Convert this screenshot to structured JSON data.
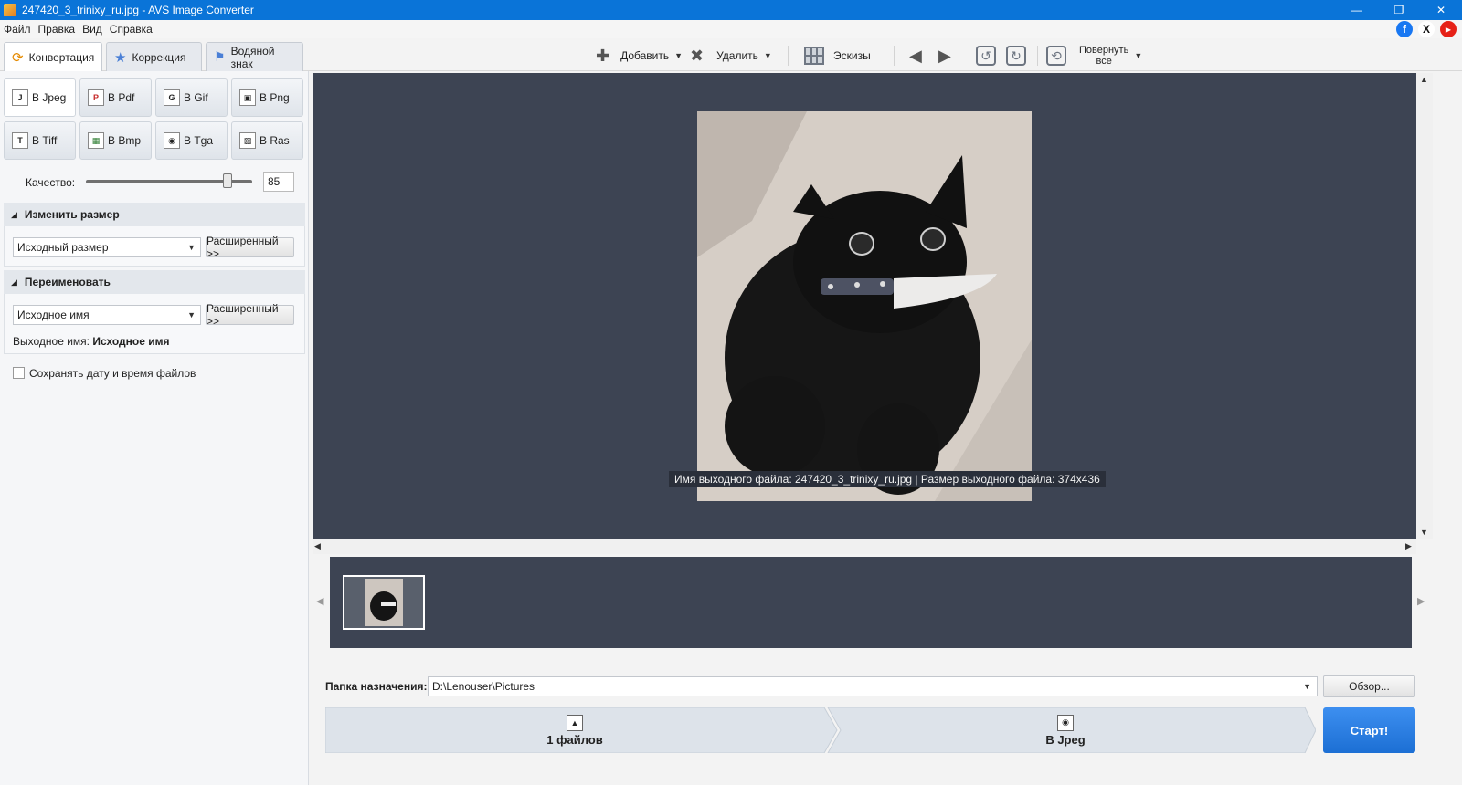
{
  "window": {
    "title": "247420_3_trinixy_ru.jpg - AVS Image Converter",
    "controls": {
      "minimize": "—",
      "restore": "❐",
      "close": "✕"
    }
  },
  "menu": [
    "Файл",
    "Правка",
    "Вид",
    "Справка"
  ],
  "social": {
    "facebook": "f",
    "x": "X",
    "youtube": "▶"
  },
  "tabs": [
    {
      "label": "Конвертация",
      "icon": "convert-icon",
      "active": true
    },
    {
      "label": "Коррекция",
      "icon": "star-icon",
      "active": false
    },
    {
      "label": "Водяной знак",
      "icon": "stamp-icon",
      "active": false
    }
  ],
  "toolbar": {
    "add_label": "Добавить",
    "delete_label": "Удалить",
    "thumbs_label": "Эскизы",
    "rotate_all_line1": "Повернуть",
    "rotate_all_line2": "все"
  },
  "formats": [
    {
      "label": "В Jpeg",
      "icon": "jpeg-icon",
      "glyph": "J",
      "active": true
    },
    {
      "label": "В Pdf",
      "icon": "pdf-icon",
      "glyph": "P",
      "active": false
    },
    {
      "label": "В Gif",
      "icon": "gif-icon",
      "glyph": "G",
      "active": false
    },
    {
      "label": "В Png",
      "icon": "png-icon",
      "glyph": "▣",
      "active": false
    },
    {
      "label": "В Tiff",
      "icon": "tiff-icon",
      "glyph": "T",
      "active": false
    },
    {
      "label": "В Bmp",
      "icon": "bmp-icon",
      "glyph": "▦",
      "active": false
    },
    {
      "label": "В Tga",
      "icon": "tga-icon",
      "glyph": "◉",
      "active": false
    },
    {
      "label": "В Ras",
      "icon": "ras-icon",
      "glyph": "▨",
      "active": false
    }
  ],
  "quality": {
    "label": "Качество:",
    "value": "85",
    "level": 0.85
  },
  "resize": {
    "title": "Изменить размер",
    "select_value": "Исходный размер",
    "advanced_label": "Расширенный >>"
  },
  "rename": {
    "title": "Переименовать",
    "select_value": "Исходное имя",
    "advanced_label": "Расширенный >>",
    "output_label": "Выходное имя:",
    "output_value": "Исходное имя"
  },
  "keep_date_label": "Сохранять дату и время файлов",
  "preview": {
    "caption": "Имя выходного файла: 247420_3_trinixy_ru.jpg | Размер выходного файла: 374x436"
  },
  "destination": {
    "label": "Папка назначения:",
    "path": "D:\\Lenouser\\Pictures",
    "browse_label": "Обзор..."
  },
  "steps": {
    "files_label": "1 файлов",
    "format_label": "В Jpeg",
    "start_label": "Старт!"
  },
  "colors": {
    "titlebar": "#0a74d8",
    "preview_bg": "#3d4453",
    "start": "#1c6fd4"
  }
}
